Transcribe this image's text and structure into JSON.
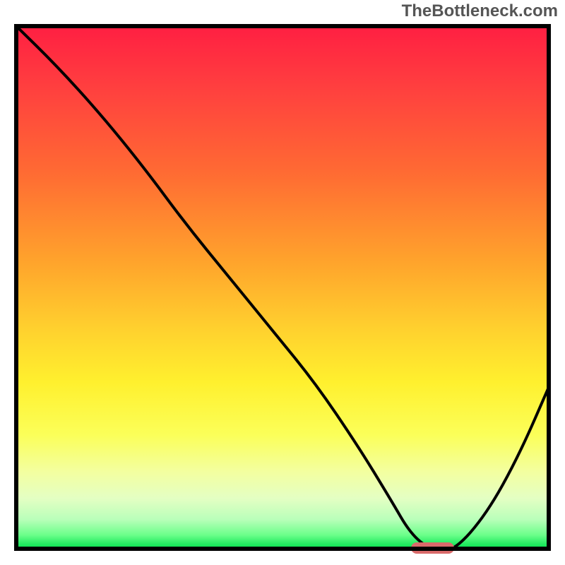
{
  "watermark": "TheBottleneck.com",
  "colors": {
    "gradient_top": "#ff1e42",
    "gradient_bottom": "#0fd657",
    "curve": "#000000",
    "marker": "#d96a6a",
    "frame_border": "#000000"
  },
  "chart_data": {
    "type": "line",
    "title": "",
    "xlabel": "",
    "ylabel": "",
    "xlim": [
      0,
      100
    ],
    "ylim": [
      0,
      100
    ],
    "grid": false,
    "legend": false,
    "series": [
      {
        "name": "bottleneck-curve",
        "x": [
          0,
          8,
          16,
          24,
          32,
          40,
          48,
          56,
          64,
          70,
          74,
          78,
          82,
          88,
          94,
          100
        ],
        "y": [
          100,
          92,
          83,
          73,
          62,
          52,
          42,
          32,
          20,
          10,
          3,
          0,
          0,
          7,
          18,
          32
        ]
      }
    ],
    "marker": {
      "x_start": 74,
      "x_end": 82,
      "y": 0,
      "label": "optimal-range"
    },
    "background_gradient": {
      "orientation": "vertical",
      "stops": [
        {
          "pos": 0.0,
          "color": "#ff1e42"
        },
        {
          "pos": 0.12,
          "color": "#ff3f3f"
        },
        {
          "pos": 0.28,
          "color": "#ff6a33"
        },
        {
          "pos": 0.45,
          "color": "#ffa32c"
        },
        {
          "pos": 0.58,
          "color": "#ffd12e"
        },
        {
          "pos": 0.68,
          "color": "#fff02e"
        },
        {
          "pos": 0.78,
          "color": "#fbff59"
        },
        {
          "pos": 0.85,
          "color": "#f3ffa0"
        },
        {
          "pos": 0.9,
          "color": "#e4ffc3"
        },
        {
          "pos": 0.94,
          "color": "#baffba"
        },
        {
          "pos": 0.97,
          "color": "#6bff8a"
        },
        {
          "pos": 0.99,
          "color": "#18e85a"
        },
        {
          "pos": 1.0,
          "color": "#0fd657"
        }
      ]
    }
  }
}
